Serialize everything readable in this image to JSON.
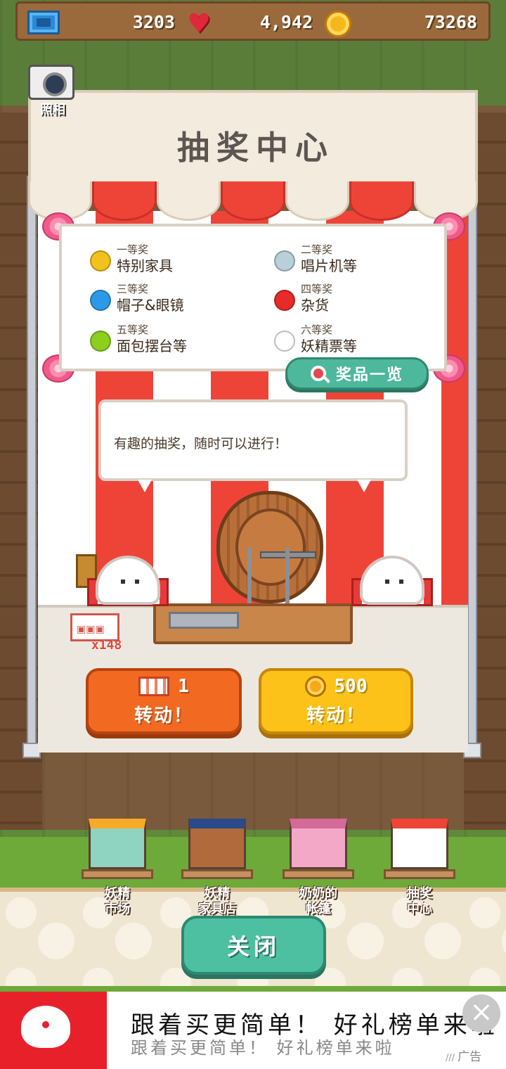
{
  "stats": {
    "tickets": "3203",
    "hearts": "4,942",
    "coins": "73268"
  },
  "photo_label": "照相",
  "booth": {
    "title": "抽奖中心",
    "prizes": [
      {
        "tier": "一等奖",
        "item": "特别家具",
        "color": "#f2c21c"
      },
      {
        "tier": "二等奖",
        "item": "唱片机等",
        "color": "#b8d0d8"
      },
      {
        "tier": "三等奖",
        "item": "帽子&眼镜",
        "color": "#2a9ae8"
      },
      {
        "tier": "四等奖",
        "item": "杂货",
        "color": "#e82a2a"
      },
      {
        "tier": "五等奖",
        "item": "面包摆台等",
        "color": "#8ccf1e"
      },
      {
        "tier": "六等奖",
        "item": "妖精票等",
        "color": "#ffffff"
      }
    ],
    "prize_list_button": "奖品一览",
    "speech": "有趣的抽奖，随时可以进行！",
    "ticket_stock": "x148"
  },
  "spin": {
    "ticket": {
      "cost": "1",
      "label": "转动！"
    },
    "coin": {
      "cost": "500",
      "label": "转动！"
    }
  },
  "shops": [
    {
      "label_line1": "妖精",
      "label_line2": "市场",
      "icon": "market-stall-icon"
    },
    {
      "label_line1": "妖精",
      "label_line2": "家具店",
      "icon": "furniture-shop-icon"
    },
    {
      "label_line1": "奶奶的",
      "label_line2": "帐篷",
      "icon": "grandma-tent-icon"
    },
    {
      "label_line1": "抽奖",
      "label_line2": "中心",
      "icon": "lottery-booth-icon"
    }
  ],
  "close_button": "关闭",
  "ad": {
    "headline": "跟着买更简单！ 好礼榜单来啦",
    "subline": "跟着买更简单！ 好礼榜单来啦",
    "tag": "广告",
    "brand_color": "#e8202a"
  }
}
